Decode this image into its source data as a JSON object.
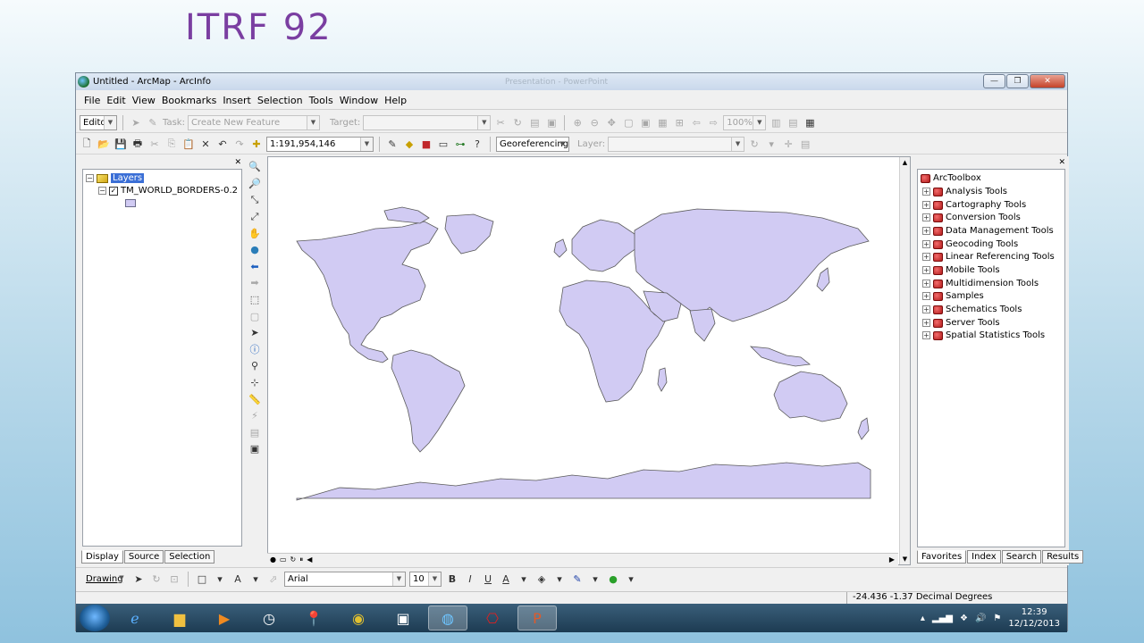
{
  "slide": {
    "title": "ITRF 92"
  },
  "window": {
    "title": "Untitled - ArcMap - ArcInfo",
    "ghost_title": "Presentation - PowerPoint",
    "buttons": [
      "—",
      "❐",
      "✕"
    ]
  },
  "menu": [
    "File",
    "Edit",
    "View",
    "Bookmarks",
    "Insert",
    "Selection",
    "Tools",
    "Window",
    "Help"
  ],
  "editor_toolbar": {
    "editor_label": "Editor",
    "task_label": "Task:",
    "task_value": "Create New Feature",
    "target_label": "Target:",
    "target_value": "",
    "zoom_value": "100%"
  },
  "standard_toolbar": {
    "scale": "1:191,954,146",
    "georef_label": "Georeferencing",
    "layer_label": "Layer:",
    "layer_value": ""
  },
  "toc": {
    "root": "Layers",
    "layer": "TM_WORLD_BORDERS-0.2",
    "tabs": [
      "Display",
      "Source",
      "Selection"
    ],
    "active_tab": "Display"
  },
  "arctoolbox": {
    "root": "ArcToolbox",
    "items": [
      "Analysis Tools",
      "Cartography Tools",
      "Conversion Tools",
      "Data Management Tools",
      "Geocoding Tools",
      "Linear Referencing Tools",
      "Mobile Tools",
      "Multidimension Tools",
      "Samples",
      "Schematics Tools",
      "Server Tools",
      "Spatial Statistics Tools"
    ],
    "tabs": [
      "Favorites",
      "Index",
      "Search",
      "Results"
    ],
    "active_tab": "Favorites"
  },
  "drawing_toolbar": {
    "drawing_label": "Drawing",
    "font": "Arial",
    "font_size": "10",
    "bold": "B",
    "italic": "I",
    "underline": "U",
    "font_color_glyph": "A"
  },
  "status": {
    "coords": "-24.436  -1.37 Decimal Degrees"
  },
  "taskbar": {
    "time": "12:39",
    "date": "12/12/2013"
  },
  "colors": {
    "slide_title": "#7a3ea1",
    "map_fill": "#d1cbf3",
    "map_stroke": "#5a5a5a",
    "selection_blue": "#3b6fd6"
  }
}
